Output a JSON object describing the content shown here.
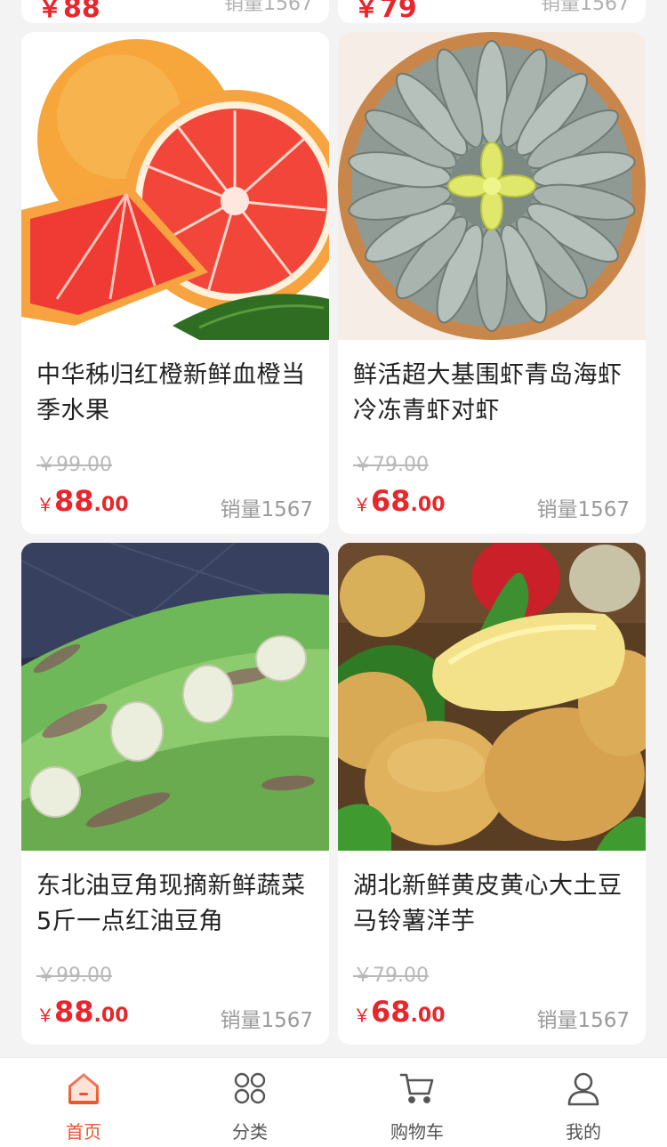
{
  "colors": {
    "price_red": "#e8262b",
    "active_tab": "#e4572e",
    "background": "#f3f3f3"
  },
  "top_partial": [
    {
      "price_int": "88",
      "sales_label": "销量1567"
    },
    {
      "price_int": "79",
      "sales_label": "销量1567"
    }
  ],
  "products": [
    {
      "title": "中华秭归红橙新鲜血橙当季水果",
      "original_price": "￥99.00",
      "currency": "￥",
      "price_int": "88",
      "price_dec": ".00",
      "sales_label": "销量1567",
      "image": "blood-orange-photo"
    },
    {
      "title": "鲜活超大基围虾青岛海虾冷冻青虾对虾",
      "original_price": "￥79.00",
      "currency": "￥",
      "price_int": "68",
      "price_dec": ".00",
      "sales_label": "销量1567",
      "image": "shrimp-plate-photo"
    },
    {
      "title": "东北油豆角现摘新鲜蔬菜5斤一点红油豆角",
      "original_price": "￥99.00",
      "currency": "￥",
      "price_int": "88",
      "price_dec": ".00",
      "sales_label": "销量1567",
      "image": "green-beans-photo"
    },
    {
      "title": "湖北新鲜黄皮黄心大土豆马铃薯洋芋",
      "original_price": "￥79.00",
      "currency": "￥",
      "price_int": "68",
      "price_dec": ".00",
      "sales_label": "销量1567",
      "image": "potatoes-photo"
    }
  ],
  "tabbar": [
    {
      "label": "首页",
      "icon": "home-icon",
      "active": true
    },
    {
      "label": "分类",
      "icon": "category-icon",
      "active": false
    },
    {
      "label": "购物车",
      "icon": "cart-icon",
      "active": false
    },
    {
      "label": "我的",
      "icon": "profile-icon",
      "active": false
    }
  ]
}
